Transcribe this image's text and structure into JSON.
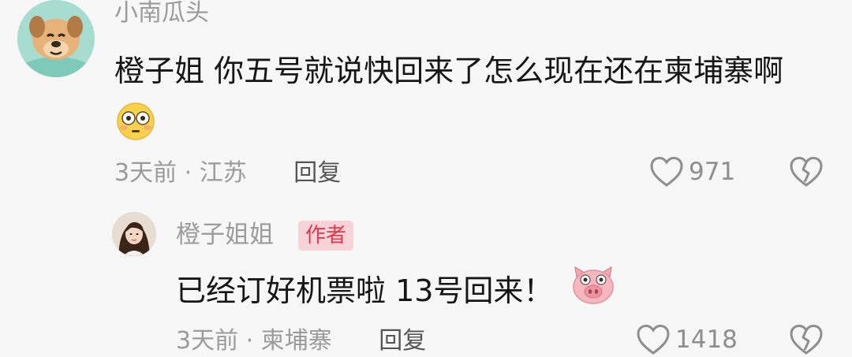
{
  "comment": {
    "username": "小南瓜头",
    "avatar_icon": "cartoon-dog-avatar",
    "text": "橙子姐 你五号就说快回来了怎么现在还在柬埔寨啊",
    "emoji_icon": "flushed-face-emoji",
    "time": "3天前",
    "separator": "·",
    "location": "江苏",
    "reply_label": "回复",
    "like_count": "971"
  },
  "reply": {
    "username": "橙子姐姐",
    "avatar_icon": "woman-photo-avatar",
    "badge_label": "作者",
    "text": "已经订好机票啦 13号回来！",
    "emoji_icon": "pig-face-emoji",
    "time": "3天前",
    "separator": "·",
    "location": "柬埔寨",
    "reply_label": "回复",
    "like_count": "1418"
  },
  "colors": {
    "background": "#f7f7f7",
    "badge_bg": "#f7d3d8",
    "badge_text": "#e7364b",
    "meta_text": "#9b9b9b"
  }
}
